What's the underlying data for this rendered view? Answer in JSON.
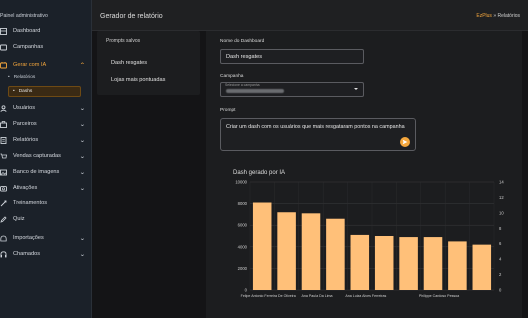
{
  "sidebar": {
    "user": "Painel administrativo",
    "items": [
      {
        "label": "Dashboard",
        "icon": "dashboard-icon",
        "chevron": false
      },
      {
        "label": "Campanhas",
        "icon": "campaign-icon",
        "chevron": false
      },
      {
        "label": "Gerar com IA",
        "icon": "ai-icon",
        "chevron": true,
        "active": true
      },
      {
        "label": "Usuários",
        "icon": "users-icon",
        "chevron": true
      },
      {
        "label": "Parceiros",
        "icon": "partners-icon",
        "chevron": true
      },
      {
        "label": "Relatórios",
        "icon": "reports-icon",
        "chevron": true
      },
      {
        "label": "Vendas capturadas",
        "icon": "sales-icon",
        "chevron": true
      },
      {
        "label": "Banco de imagens",
        "icon": "images-icon",
        "chevron": true
      },
      {
        "label": "Ativações",
        "icon": "activations-icon",
        "chevron": true
      },
      {
        "label": "Treinamentos",
        "icon": "training-icon",
        "chevron": false
      },
      {
        "label": "Quiz",
        "icon": "quiz-icon",
        "chevron": false
      },
      {
        "label": "Importações",
        "icon": "import-icon",
        "chevron": true
      },
      {
        "label": "Chamados",
        "icon": "tickets-icon",
        "chevron": true
      }
    ],
    "subitems": [
      {
        "label": "Relatórios"
      },
      {
        "label": "Dashs"
      }
    ]
  },
  "topbar": {
    "title": "Gerador de relatório",
    "crumb_root": "EzPlus",
    "crumb_sep": "»",
    "crumb_current": "Relatórios"
  },
  "saved_prompts": {
    "header": "Prompts salvos",
    "items": [
      "Dash resgates",
      "Lojas mais pontuadas"
    ]
  },
  "form": {
    "name_label": "Nome do Dashboard",
    "name_value": "Dash resgates",
    "campaign_label": "Campanha",
    "campaign_hint": "Selecione a campanha",
    "prompt_label": "Prompt",
    "prompt_value": "Criar um dash com os usuários que mais resgataram pontos na campanha"
  },
  "chart_data": {
    "type": "bar",
    "title": "Dash gerado por IA",
    "categories": [
      "Felipe Antonio Ferreira De Oliveira",
      "",
      "Ana Paula Da Lima",
      "",
      "Ana Luiza Alves Ferreiras",
      "",
      "",
      "Philippe Cardoso Pessoa",
      "",
      ""
    ],
    "values": [
      8100,
      7200,
      7100,
      6600,
      5100,
      5000,
      4900,
      4900,
      4500,
      4200
    ],
    "ylim": [
      0,
      10000
    ],
    "yticks": [
      "0",
      "2000",
      "4000",
      "6000",
      "8000",
      "10000"
    ],
    "y2ticks": [
      "0",
      "2",
      "4",
      "6",
      "8",
      "10",
      "12",
      "14"
    ],
    "bar_color": "#ffc079"
  }
}
